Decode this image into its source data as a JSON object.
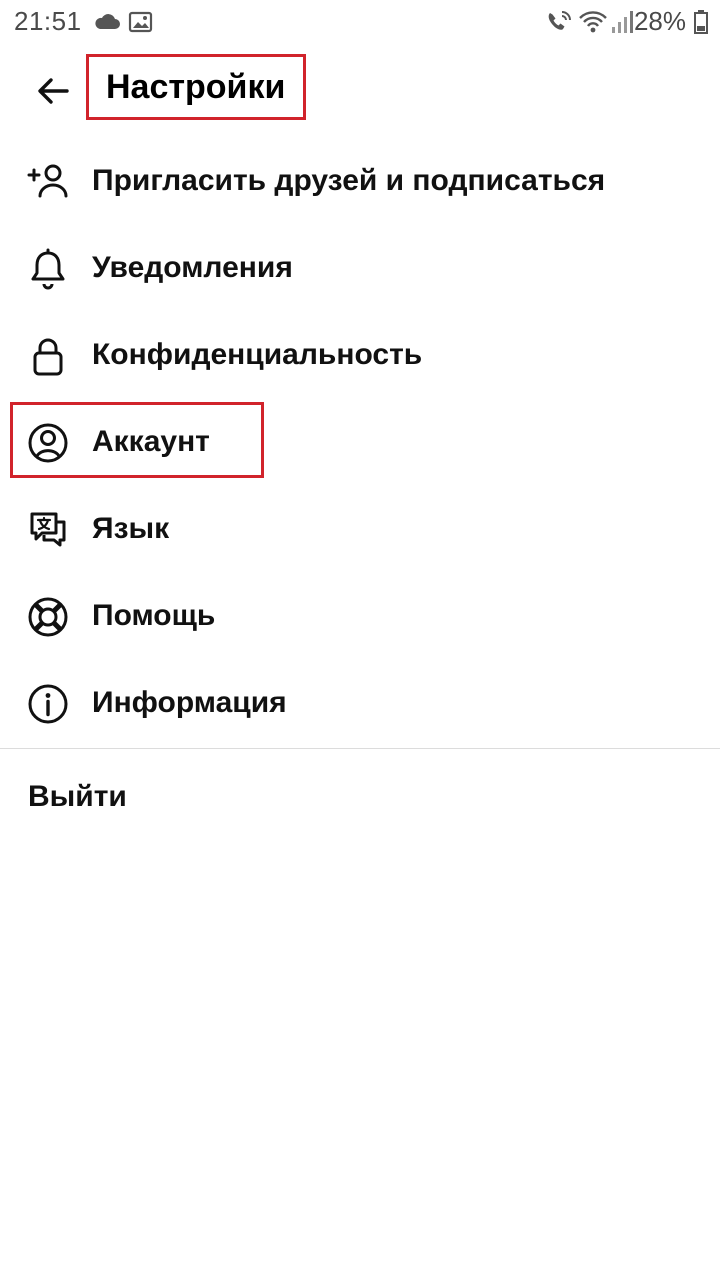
{
  "status_bar": {
    "time": "21:51",
    "battery_percent": "28%",
    "icons": [
      "cloud-icon",
      "image-icon",
      "wifi-call-icon",
      "wifi-icon",
      "signal-icon",
      "battery-icon"
    ]
  },
  "header": {
    "back_icon": "arrow-left-icon",
    "title": "Настройки"
  },
  "menu": {
    "items": [
      {
        "label": "Пригласить друзей и подписаться",
        "icon": "add-person-icon"
      },
      {
        "label": "Уведомления",
        "icon": "bell-icon"
      },
      {
        "label": "Конфиденциальность",
        "icon": "lock-icon"
      },
      {
        "label": "Аккаунт",
        "icon": "account-circle-icon",
        "highlighted": true
      },
      {
        "label": "Язык",
        "icon": "language-chat-icon"
      },
      {
        "label": "Помощь",
        "icon": "lifebuoy-icon"
      },
      {
        "label": "Информация",
        "icon": "info-icon"
      }
    ]
  },
  "logout": {
    "label": "Выйти"
  },
  "colors": {
    "highlight": "#d1232b",
    "text": "#111111",
    "status_text": "#4a4a4a",
    "divider": "#dcdcdc"
  }
}
